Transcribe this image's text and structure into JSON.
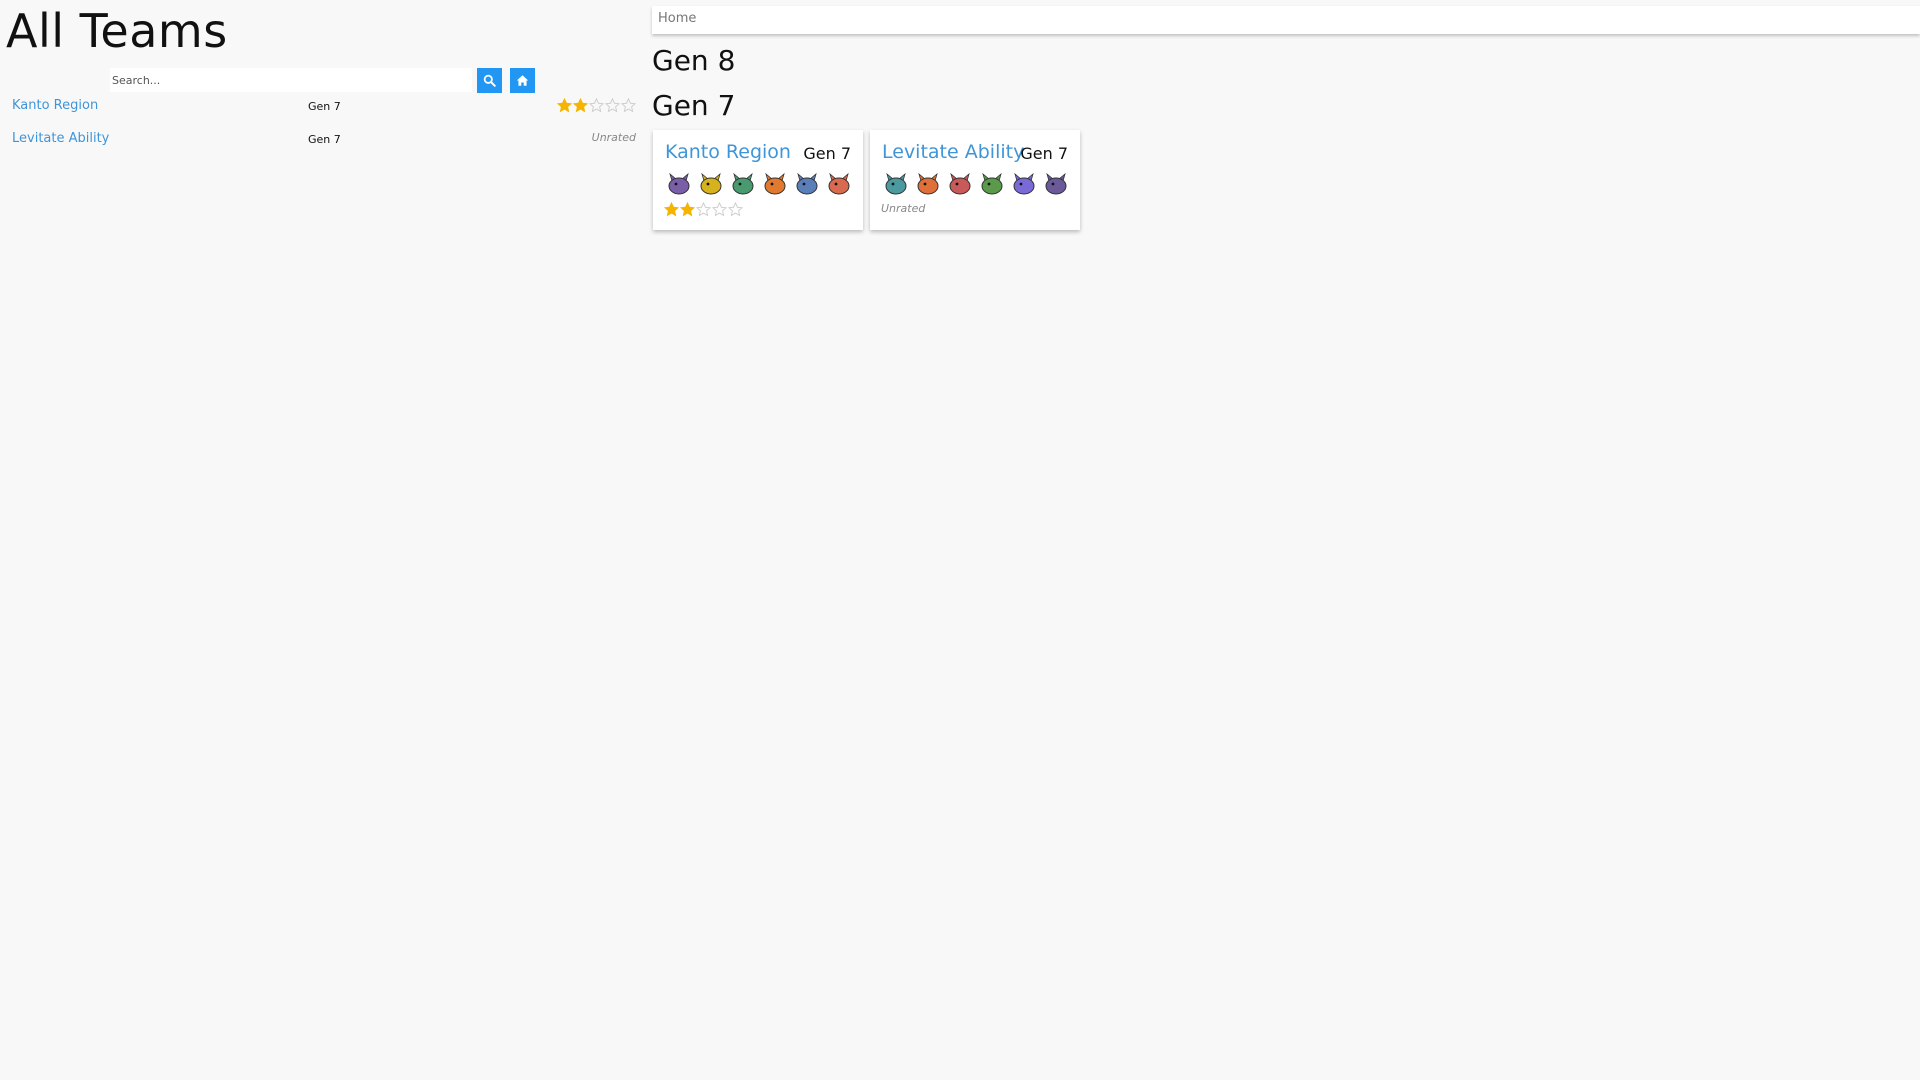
{
  "sidebar": {
    "title": "All Teams",
    "search": {
      "placeholder": "Search...",
      "value": ""
    },
    "search_button_icon": "search-icon",
    "home_button_icon": "home-icon",
    "teams": [
      {
        "name": "Kanto Region",
        "gen": "Gen 7",
        "rating": 2,
        "max_rating": 5
      },
      {
        "name": "Levitate Ability",
        "gen": "Gen 7",
        "rating_text": "Unrated"
      }
    ]
  },
  "breadcrumb": {
    "home": "Home"
  },
  "main": {
    "sections": [
      {
        "heading": "Gen 8"
      },
      {
        "heading": "Gen 7"
      }
    ],
    "cards": [
      {
        "title": "Kanto Region",
        "gen": "Gen 7",
        "rating": 2,
        "max_rating": 5,
        "sprite_colors": [
          "#7a5ea8",
          "#d6b21f",
          "#4a9a70",
          "#e07a30",
          "#5a7fb8",
          "#d86a50"
        ]
      },
      {
        "title": "Levitate Ability",
        "gen": "Gen 7",
        "rating_text": "Unrated",
        "sprite_colors": [
          "#4a9aa0",
          "#e0703a",
          "#c85a5a",
          "#5a9a4a",
          "#7a6ad8",
          "#6a5a9a"
        ]
      }
    ]
  },
  "colors": {
    "accent": "#2196f3",
    "link": "#3f95d8",
    "star_filled": "#f5b400",
    "star_empty": "#cccccc",
    "background": "#f8f8f8"
  }
}
